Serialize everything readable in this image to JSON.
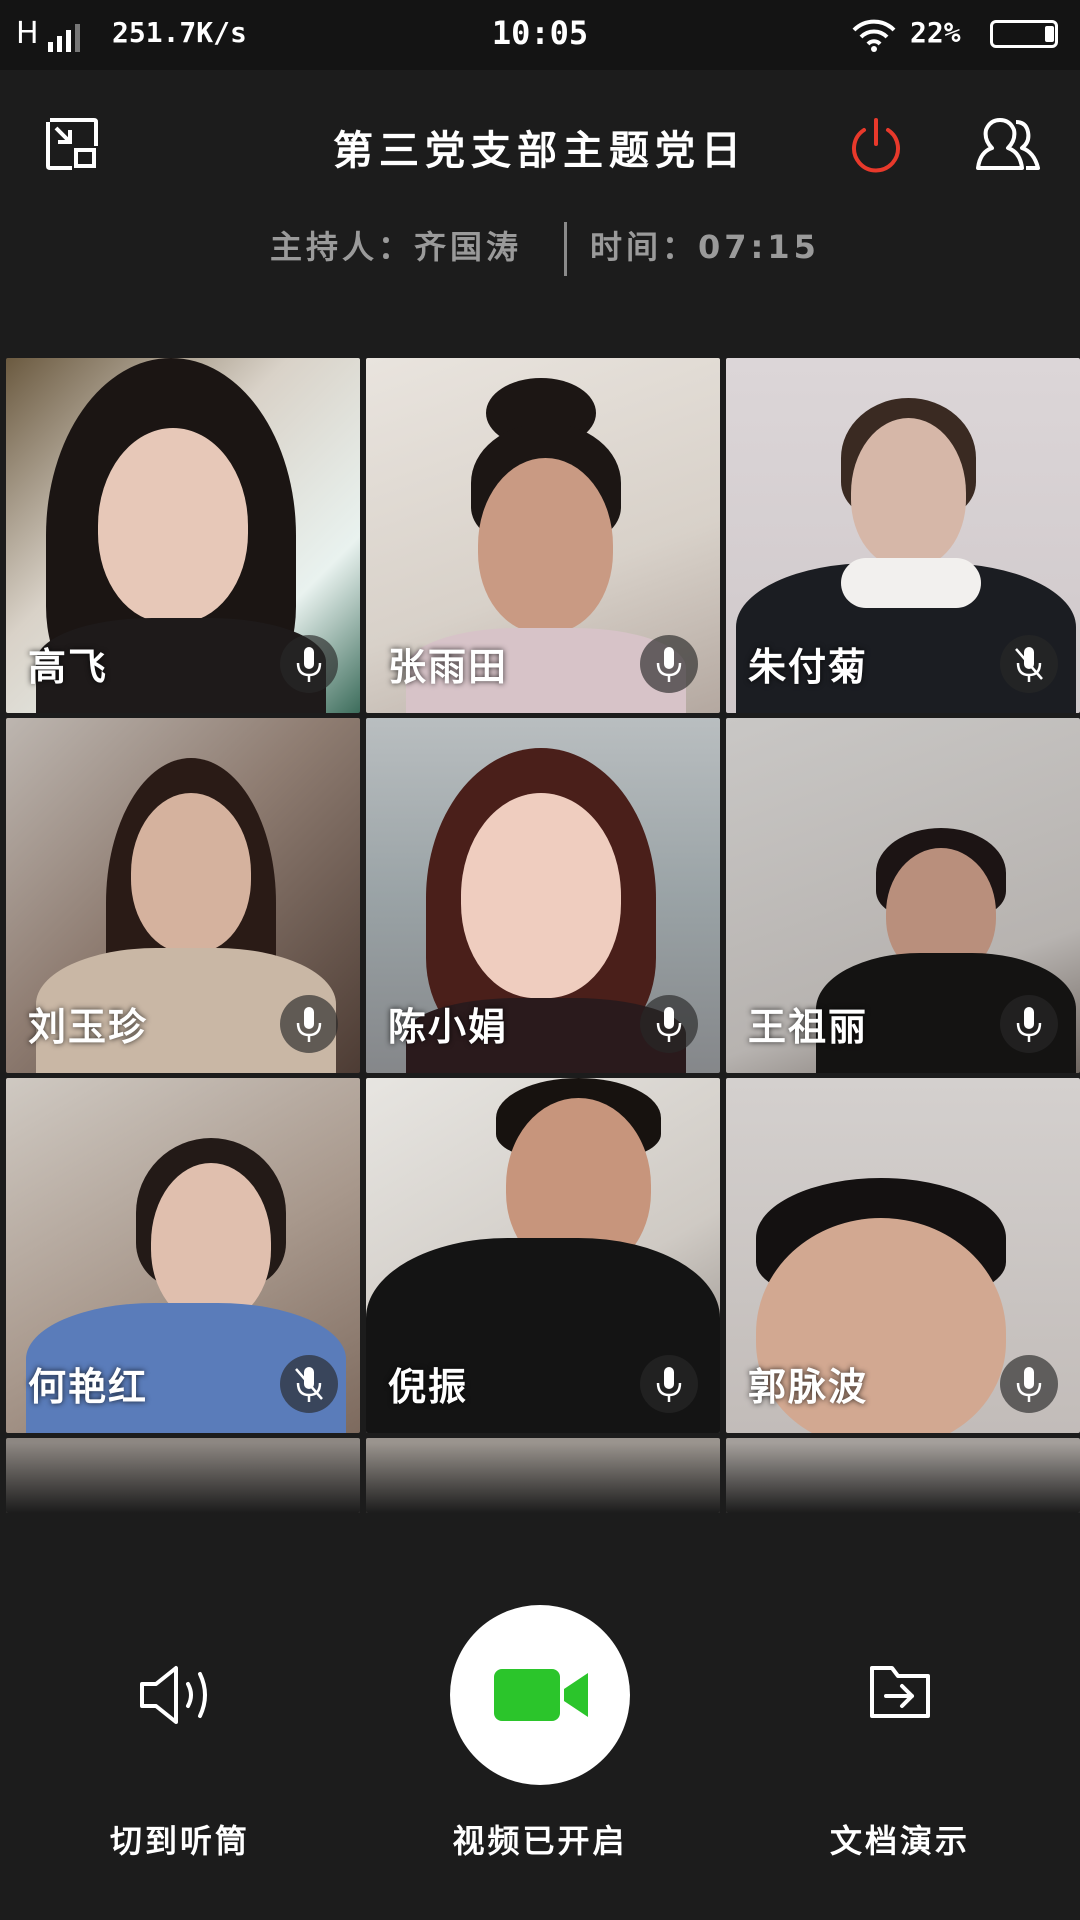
{
  "status_bar": {
    "network": "H",
    "speed": "251.7K/s",
    "time": "10:05",
    "battery": "22%"
  },
  "header": {
    "title": "第三党支部主题党日",
    "host": "主持人：齐国涛",
    "elapsed": "时间：07:15"
  },
  "participants": [
    {
      "name": "高飞",
      "mic": "on"
    },
    {
      "name": "张雨田",
      "mic": "on"
    },
    {
      "name": "朱付菊",
      "mic": "muted"
    },
    {
      "name": "刘玉珍",
      "mic": "on"
    },
    {
      "name": "陈小娟",
      "mic": "on"
    },
    {
      "name": "王祖丽",
      "mic": "on"
    },
    {
      "name": "何艳红",
      "mic": "muted"
    },
    {
      "name": "倪振",
      "mic": "on"
    },
    {
      "name": "郭脉波",
      "mic": "on"
    }
  ],
  "controls": {
    "earpiece_label": "切到听筒",
    "video_label": "视频已开启",
    "doc_label": "文档演示"
  },
  "colors": {
    "background": "#1c1c1c",
    "power_red": "#e8392b",
    "video_green": "#2bc52b"
  },
  "icons": [
    "shrink-window-icon",
    "power-icon",
    "participants-icon",
    "speaker-icon",
    "video-camera-icon",
    "folder-share-icon",
    "microphone-icon",
    "microphone-muted-icon"
  ]
}
